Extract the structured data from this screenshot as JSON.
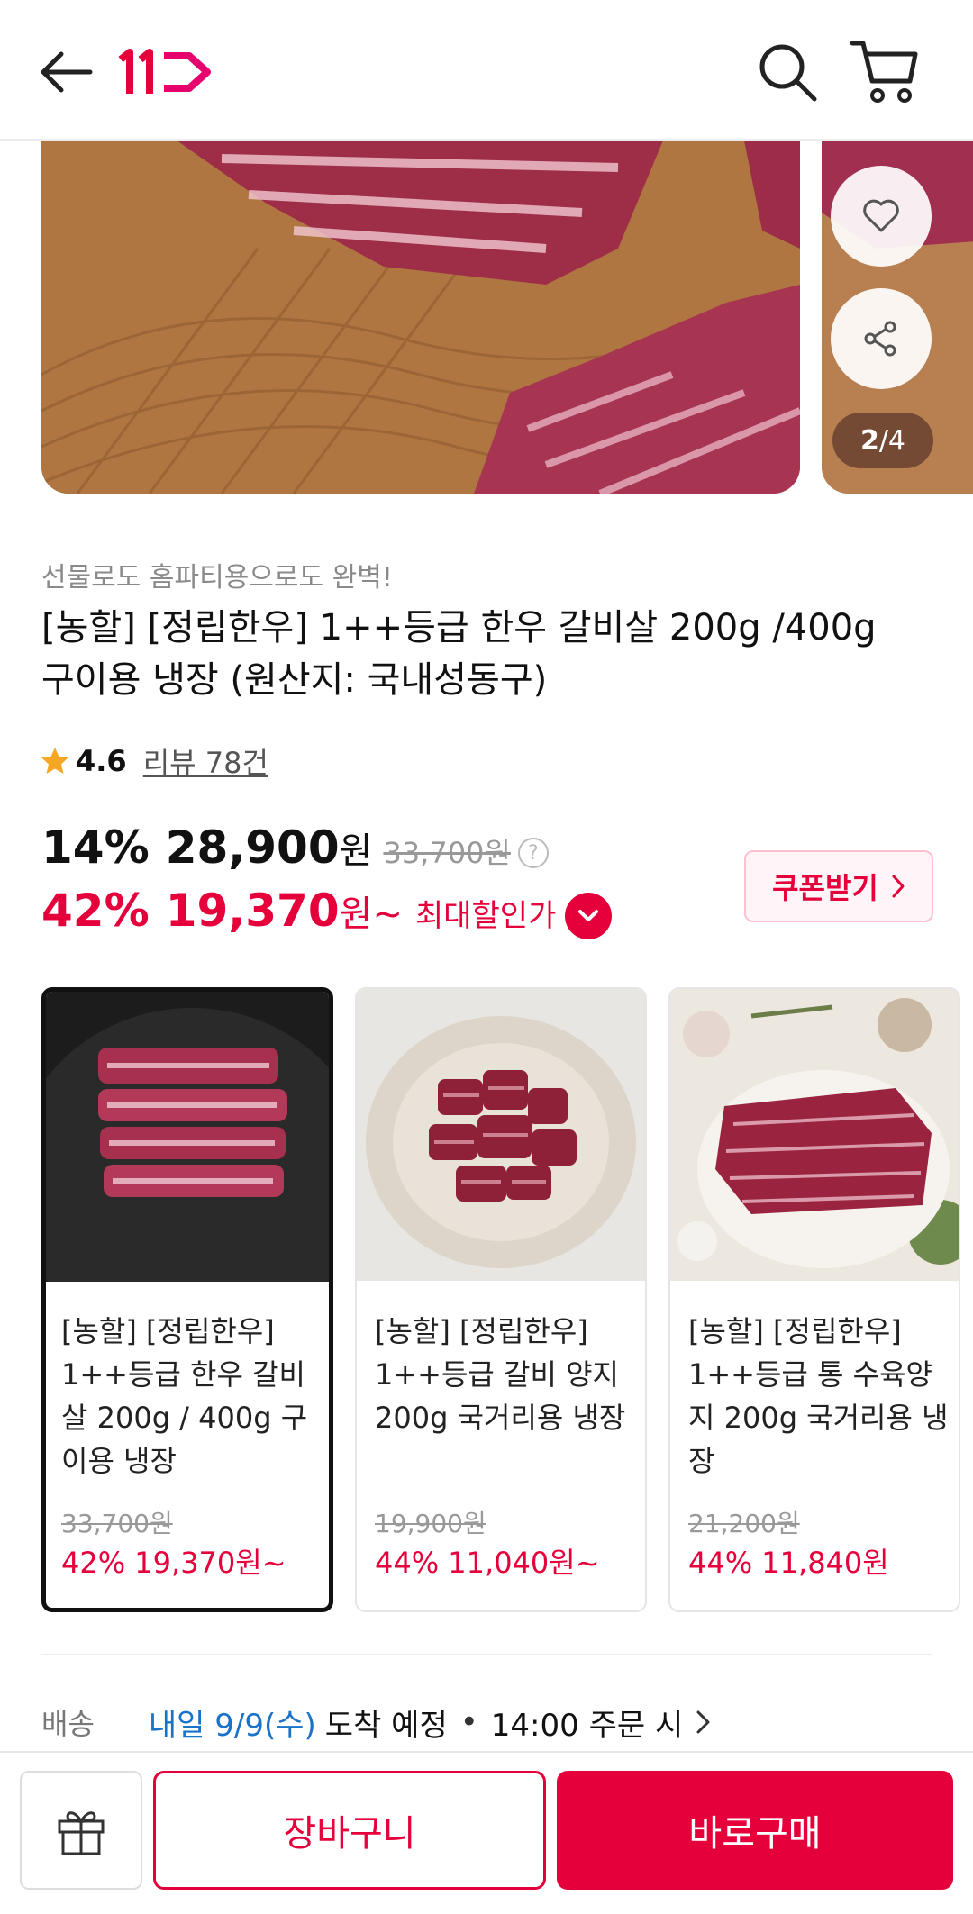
{
  "header": {
    "back_icon": "arrow-left-icon",
    "logo_text": "11",
    "search_icon": "search-icon",
    "cart_icon": "cart-icon"
  },
  "carousel": {
    "current": "2",
    "total": "/4",
    "wish_icon": "heart-icon",
    "share_icon": "share-icon"
  },
  "product": {
    "promo": "선물로도 홈파티용으로도 완벽!",
    "title": "[농할] [정립한우] 1++등급 한우 갈비살 200g /400g 구이용 냉장  (원산지: 국내성동구)",
    "rating": "4.6",
    "review_link": "리뷰 78건"
  },
  "price": {
    "discount": "14%",
    "sale_price": "28,900",
    "won": "원",
    "original": "33,700원",
    "help": "?",
    "max_discount": "42%",
    "max_price": "19,370",
    "max_won": "원~",
    "max_label": "최대할인가",
    "coupon_label": "쿠폰받기"
  },
  "options": [
    {
      "name": "[농할] [정립한우] 1++등급 한우 갈비살 200g / 400g 구이용 냉장",
      "original": "33,700원",
      "price": "42% 19,370원~"
    },
    {
      "name": "[농할] [정립한우] 1++등급 갈비 양지 200g 국거리용 냉장",
      "original": "19,900원",
      "price": "44% 11,040원~"
    },
    {
      "name": "[농할] [정립한우] 1++등급 통 수육양지 200g 국거리용 냉장",
      "original": "21,200원",
      "price": "44% 11,840원"
    }
  ],
  "delivery": {
    "label": "배송",
    "date": "내일 9/9(수)",
    "arrival": "도착 예정",
    "dot": "•",
    "cutoff": "14:00 주문 시"
  },
  "bottom": {
    "gift_icon": "gift-icon",
    "cart_label": "장바구니",
    "buy_label": "바로구매"
  },
  "colors": {
    "accent": "#e5003b",
    "link_blue": "#1a73c8"
  }
}
